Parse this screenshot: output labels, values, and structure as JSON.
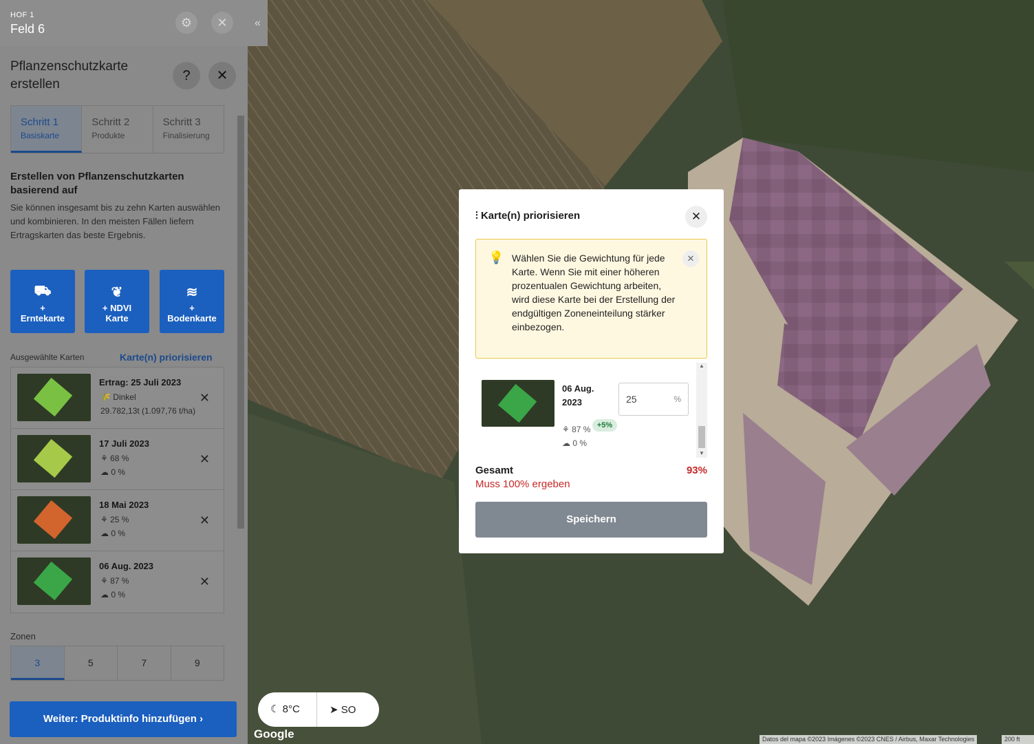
{
  "header": {
    "farm_label": "HOF 1",
    "field_name": "Feld 6",
    "settings_icon": "gear-icon",
    "close_icon": "close-icon",
    "collapse_icon": "double-chevron-left-icon"
  },
  "panel": {
    "title": "Pflanzenschutzkarte erstellen",
    "help_icon": "help-icon",
    "close_icon": "close-icon",
    "steps": [
      {
        "label": "Schritt 1",
        "sub": "Basiskarte"
      },
      {
        "label": "Schritt 2",
        "sub": "Produkte"
      },
      {
        "label": "Schritt 3",
        "sub": "Finalisierung"
      }
    ],
    "section_title": "Erstellen von Pflanzenschutzkarten basierend auf",
    "section_desc": "Sie können insgesamt bis zu zehn Karten auswählen und kombinieren. In den meisten Fällen liefern Ertragskarten das beste Ergebnis.",
    "map_buttons": [
      {
        "icon": "harvester-icon",
        "plus": "+",
        "label": "Erntekarte"
      },
      {
        "icon": "sprout-icon",
        "plus": "+ NDVI",
        "label": "Karte"
      },
      {
        "icon": "soil-waves-icon",
        "plus": "+",
        "label": "Bodenkarte"
      }
    ],
    "selected_label": "Ausgewählte Karten",
    "prioritize_link": "Karte(n) priorisieren",
    "selected_maps": [
      {
        "title": "Ertrag: 25 Juli 2023",
        "line1": "Dinkel",
        "line2": "29.782,13t (1.097,76 t/ha)",
        "color": "#7ac143"
      },
      {
        "title": "17 Juli 2023",
        "line1": "68 %",
        "line2": "0 %",
        "color": "#a6c94a"
      },
      {
        "title": "18 Mai 2023",
        "line1": "25 %",
        "line2": "0 %",
        "color": "#d2642e"
      },
      {
        "title": "06 Aug. 2023",
        "line1": "87 %",
        "line2": "0 %",
        "color": "#3aa648"
      }
    ],
    "zones_label": "Zonen",
    "zones": [
      "3",
      "5",
      "7",
      "9"
    ],
    "next_button": "Weiter: Produktinfo hinzufügen"
  },
  "modal": {
    "title": "Karte(n) priorisieren",
    "tip": "Wählen Sie die Gewichtung für jede Karte. Wenn Sie mit einer höheren prozentualen Gewichtung arbeiten, wird diese Karte bei der Erstellung der endgültigen Zoneneinteilung stärker einbezogen.",
    "item": {
      "date": "06 Aug. 2023",
      "weight": "25",
      "unit": "%",
      "ndvi": "87 %",
      "badge": "+5%",
      "cloud": "0 %"
    },
    "total_label": "Gesamt",
    "total_value": "93%",
    "error": "Muss 100% ergeben",
    "save": "Speichern"
  },
  "weather": {
    "temp": "8°C",
    "wind": "SO"
  },
  "google": "Google",
  "attribution": "Datos del mapa ©2023 Imágenes ©2023 CNES / Airbus, Maxar Technologies",
  "scale": "200 ft"
}
